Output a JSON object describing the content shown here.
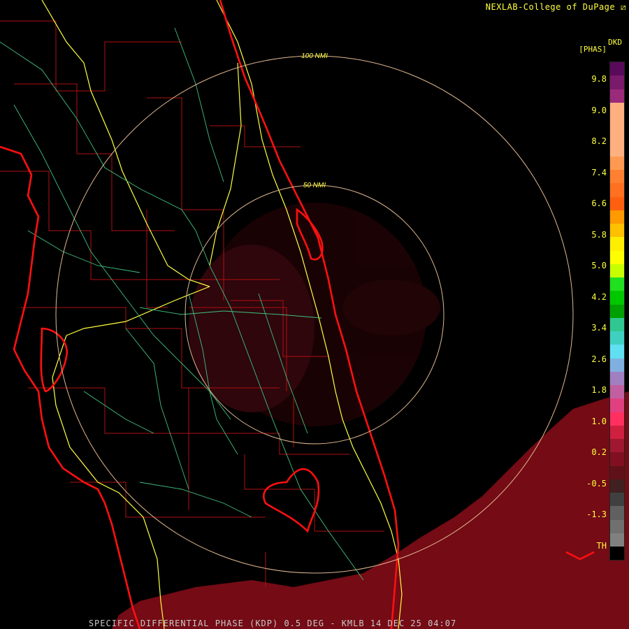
{
  "header": {
    "source_label": "NEXLAB-College of DuPage"
  },
  "footer": {
    "product_line": "SPECIFIC DIFFERENTIAL PHASE (KDP) 0.5 DEG - KMLB 14 DEC 25 04:07"
  },
  "legend": {
    "product_code": "DKD",
    "unit_label": "[PHAS]",
    "tick_labels": [
      "9.8",
      "9.0",
      "8.2",
      "7.4",
      "6.6",
      "5.8",
      "5.0",
      "4.2",
      "3.4",
      "2.6",
      "1.8",
      "1.0",
      "0.2",
      "-0.5",
      "-1.3",
      "TH"
    ],
    "colors": [
      "#5a0a5a",
      "#7a1a6a",
      "#9c2a7a",
      "#ffb080",
      "#ffb080",
      "#ffb080",
      "#ffb080",
      "#ff9a50",
      "#ff8030",
      "#ff7020",
      "#ff6010",
      "#ff9a00",
      "#ffc000",
      "#ffee00",
      "#ffff00",
      "#c8ff00",
      "#20e020",
      "#00c800",
      "#00a000",
      "#30c890",
      "#40d0c0",
      "#60e0f0",
      "#80b0e0",
      "#a080c0",
      "#c060a0",
      "#e04080",
      "#ff3060",
      "#d02040",
      "#a01830",
      "#801020",
      "#601018",
      "#402020",
      "#404040",
      "#606060",
      "#707070",
      "#808080",
      "#000000"
    ]
  },
  "range_rings": [
    {
      "label": "100 NMI"
    },
    {
      "label": "50 NMI"
    }
  ]
}
